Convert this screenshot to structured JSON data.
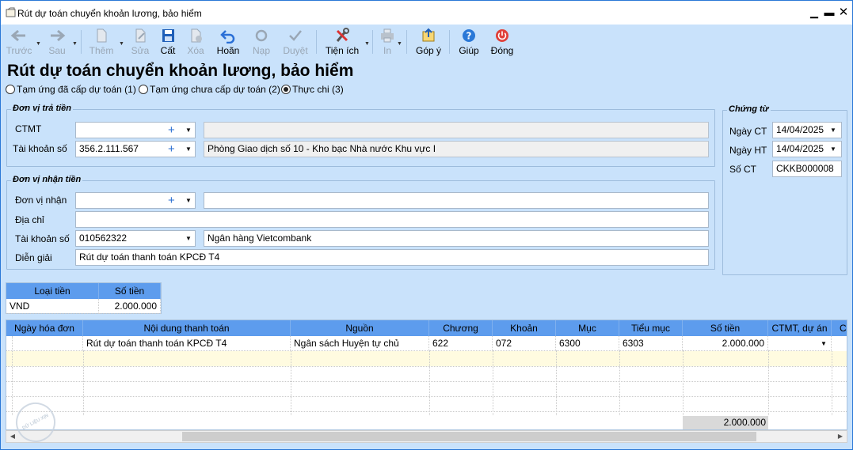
{
  "window": {
    "title": "Rút dự toán chuyển khoản lương, bảo hiểm"
  },
  "toolbar": {
    "back": "Trước",
    "next": "Sau",
    "add": "Thêm",
    "edit": "Sửa",
    "save": "Cất",
    "delete": "Xóa",
    "undo": "Hoãn",
    "reload": "Nạp",
    "approve": "Duyệt",
    "utilities": "Tiện ích",
    "print": "In",
    "feedback": "Góp ý",
    "help": "Giúp",
    "close": "Đóng"
  },
  "page": {
    "title": "Rút dự toán chuyển khoản lương, bảo hiểm"
  },
  "radios": [
    {
      "label": "Tạm ứng đã cấp dự toán (1)",
      "checked": false
    },
    {
      "label": "Tạm ứng chưa cấp dự toán (2)",
      "checked": false
    },
    {
      "label": "Thực chi (3)",
      "checked": true
    }
  ],
  "payer": {
    "legend": "Đơn vị trả tiền",
    "ctmt_label": "CTMT",
    "ctmt_value": "",
    "ctmt_desc": "",
    "account_label": "Tài khoản số",
    "account_value": "356.2.111.567",
    "account_desc": "Phòng Giao dịch số 10 - Kho bạc Nhà nước Khu vực I"
  },
  "receiver": {
    "legend": "Đơn vị nhận tiền",
    "unit_label": "Đơn vị nhận",
    "unit_value": "",
    "unit_desc": "",
    "address_label": "Địa chỉ",
    "address_value": "",
    "account_label": "Tài khoản số",
    "account_value": "010562322",
    "account_desc": "Ngân hàng Vietcombank",
    "note_label": "Diễn giải",
    "note_value": "Rút dự toán thanh toán KPCĐ T4"
  },
  "voucher": {
    "legend": "Chứng từ",
    "date_ct_label": "Ngày CT",
    "date_ct": "14/04/2025",
    "date_ht_label": "Ngày HT",
    "date_ht": "14/04/2025",
    "no_label": "Số CT",
    "no": "CKKB000008"
  },
  "currency_table": {
    "headers": [
      "Loại tiền",
      "Số tiền"
    ],
    "rows": [
      [
        "VND",
        "2.000.000"
      ]
    ]
  },
  "detail_table": {
    "headers": [
      "Ngày hóa đơn",
      "Nội dung thanh toán",
      "Nguồn",
      "Chương",
      "Khoản",
      "Mục",
      "Tiểu mục",
      "Số tiền",
      "CTMT, dự án",
      "C"
    ],
    "rows": [
      [
        "",
        "Rút dự toán thanh toán KPCĐ T4",
        "Ngân sách Huyện tự chủ",
        "622",
        "072",
        "6300",
        "6303",
        "2.000.000",
        ""
      ]
    ],
    "total": "2.000.000"
  },
  "watermark": "DỮ LIỆU XỊN",
  "colors": {
    "header_blue": "#5d9ced",
    "background": "#c9e2fb",
    "accent": "#2a78d7"
  }
}
